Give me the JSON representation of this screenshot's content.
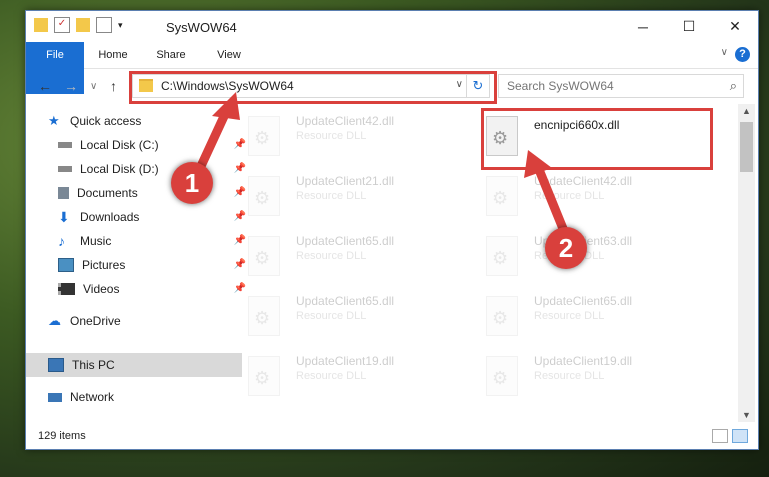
{
  "window": {
    "title": "SysWOW64"
  },
  "caption_buttons": {
    "minimize": "─",
    "maximize": "☐",
    "close": "✕"
  },
  "ribbon": {
    "tabs": [
      "File",
      "Home",
      "Share",
      "View"
    ],
    "help": "?",
    "collapse": "∨"
  },
  "nav": {
    "back": "←",
    "forward": "→",
    "recent": "∨",
    "up": "↑"
  },
  "address": {
    "path": "C:\\Windows\\SysWOW64",
    "dropdown": "∨",
    "refresh": "↻"
  },
  "search": {
    "placeholder": "Search SysWOW64",
    "icon": "⌕"
  },
  "sidebar": {
    "items": [
      {
        "label": "Quick access",
        "icon": "star-icon",
        "color": "#1a6ed2"
      },
      {
        "label": "Local Disk (C:)",
        "icon": "drive-icon",
        "color": "#555555",
        "pinned": "📌"
      },
      {
        "label": "Local Disk (D:)",
        "icon": "drive-icon",
        "color": "#555555",
        "pinned": "📌"
      },
      {
        "label": "Documents",
        "icon": "documents-icon",
        "color": "#6c7a89",
        "pinned": "📌"
      },
      {
        "label": "Downloads",
        "icon": "downloads-icon",
        "color": "#1a6ed2",
        "pinned": "📌"
      },
      {
        "label": "Music",
        "icon": "music-icon",
        "color": "#1a6ed2",
        "pinned": "📌"
      },
      {
        "label": "Pictures",
        "icon": "pictures-icon",
        "color": "#4a90c2",
        "pinned": "📌"
      },
      {
        "label": "Videos",
        "icon": "videos-icon",
        "color": "#333333",
        "pinned": "📌"
      },
      {
        "label": "OneDrive",
        "icon": "cloud-icon",
        "color": "#1a6ed2"
      },
      {
        "label": "This PC",
        "icon": "computer-icon",
        "color": "#3a76b6"
      },
      {
        "label": "Network",
        "icon": "network-icon",
        "color": "#3a76b6"
      }
    ]
  },
  "files": {
    "left": [
      {
        "name": "UpdateClient42.dll",
        "type": "Resource DLL"
      },
      {
        "name": "UpdateClient21.dll",
        "type": "Resource DLL"
      },
      {
        "name": "UpdateClient65.dll",
        "type": "Resource DLL"
      },
      {
        "name": "UpdateClient65.dll",
        "type": "Resource DLL"
      },
      {
        "name": "UpdateClient19.dll",
        "type": "Resource DLL"
      }
    ],
    "right": [
      {
        "name": "encnipci660x.dll",
        "type": ""
      },
      {
        "name": "UpdateClient42.dll",
        "type": "Resource DLL"
      },
      {
        "name": "UpdateClient63.dll",
        "type": "Resource DLL"
      },
      {
        "name": "UpdateClient65.dll",
        "type": "Resource DLL"
      },
      {
        "name": "UpdateClient19.dll",
        "type": "Resource DLL"
      }
    ]
  },
  "status": {
    "count": "129 items"
  },
  "callouts": {
    "one": "1",
    "two": "2"
  },
  "colors": {
    "accent": "#1a6ed2",
    "highlight": "#d9403c"
  }
}
